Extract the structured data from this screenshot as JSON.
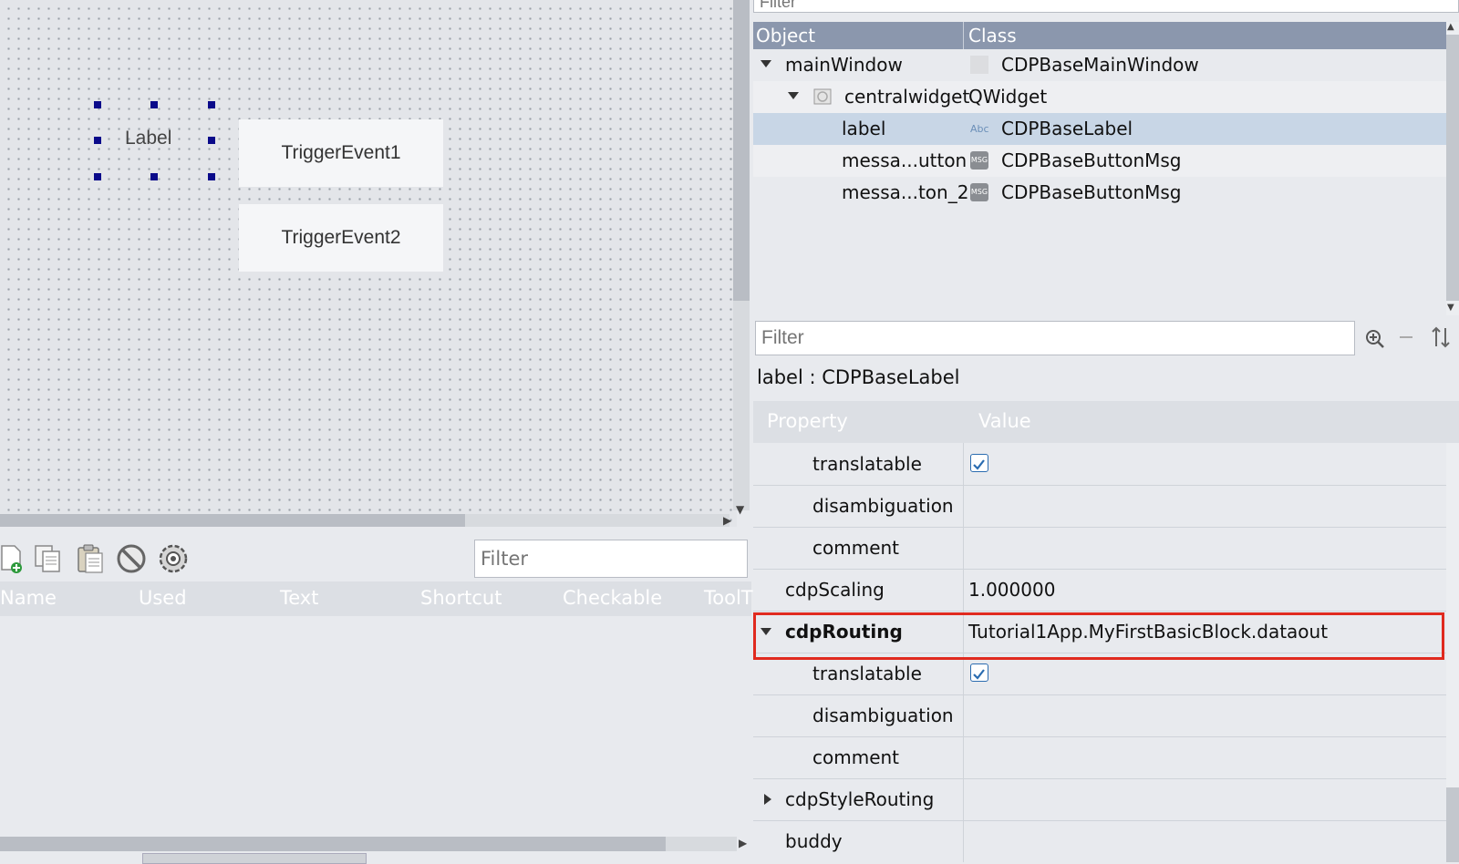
{
  "canvas": {
    "label_text": "Label",
    "buttons": [
      "TriggerEvent1",
      "TriggerEvent2"
    ]
  },
  "action_editor": {
    "filter_placeholder": "Filter",
    "columns": [
      "Name",
      "Used",
      "Text",
      "Shortcut",
      "Checkable",
      "ToolT"
    ],
    "icons": [
      "new-action-icon",
      "copy-icon",
      "paste-icon",
      "delete-icon",
      "configure-icon"
    ]
  },
  "object_inspector": {
    "filter_placeholder": "Filter",
    "columns": [
      "Object",
      "Class"
    ],
    "rows": [
      {
        "name": "mainWindow",
        "class": "CDPBaseMainWindow",
        "icon": "window-icon"
      },
      {
        "name": "centralwidget",
        "class": "QWidget",
        "icon": "widget-icon"
      },
      {
        "name": "label",
        "class": "CDPBaseLabel",
        "icon": "label-abc-icon",
        "icon_text": "Abc"
      },
      {
        "name": "messa...utton",
        "class": "CDPBaseButtonMsg",
        "icon": "msg-button-icon",
        "icon_text": "MSG"
      },
      {
        "name": "messa...ton_2",
        "class": "CDPBaseButtonMsg",
        "icon": "msg-button-icon",
        "icon_text": "MSG"
      }
    ]
  },
  "property_editor": {
    "filter_placeholder": "Filter",
    "title": "label : CDPBaseLabel",
    "columns": [
      "Property",
      "Value"
    ],
    "rows": [
      {
        "name": "translatable",
        "value": "",
        "checked": true
      },
      {
        "name": "disambiguation",
        "value": ""
      },
      {
        "name": "comment",
        "value": ""
      },
      {
        "name": "cdpScaling",
        "value": "1.000000"
      },
      {
        "name": "cdpRouting",
        "value": "Tutorial1App.MyFirstBasicBlock.dataout"
      },
      {
        "name": "translatable",
        "value": "",
        "checked": true
      },
      {
        "name": "disambiguation",
        "value": ""
      },
      {
        "name": "comment",
        "value": ""
      },
      {
        "name": "cdpStyleRouting",
        "value": ""
      },
      {
        "name": "buddy",
        "value": ""
      }
    ],
    "highlight_color": "#e02a1f"
  }
}
